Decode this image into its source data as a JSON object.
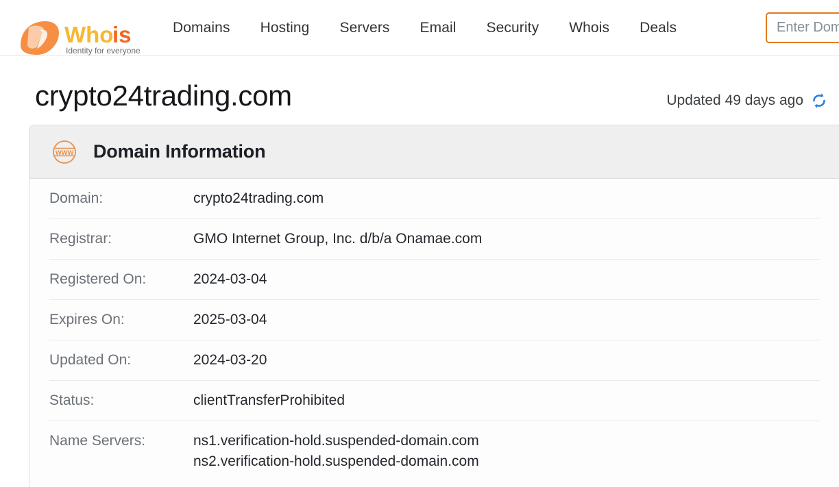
{
  "header": {
    "logo": {
      "name": "whois-logo",
      "word_primary": "Who",
      "word_accent": "is",
      "tagline": "Identity for everyone",
      "mark_color": "#f58634",
      "primary_color": "#f7b731",
      "accent_color": "#f26722"
    },
    "nav": [
      {
        "label": "Domains",
        "name": "nav-domains"
      },
      {
        "label": "Hosting",
        "name": "nav-hosting"
      },
      {
        "label": "Servers",
        "name": "nav-servers"
      },
      {
        "label": "Email",
        "name": "nav-email"
      },
      {
        "label": "Security",
        "name": "nav-security"
      },
      {
        "label": "Whois",
        "name": "nav-whois"
      },
      {
        "label": "Deals",
        "name": "nav-deals"
      }
    ],
    "search": {
      "placeholder": "Enter Domain Name",
      "value": "",
      "border_color": "#e07b1f"
    }
  },
  "page": {
    "title": "crypto24trading.com",
    "updated_text": "Updated 49 days ago",
    "refresh_icon": "refresh-icon",
    "refresh_color": "#2f7de1"
  },
  "card": {
    "icon": "www-globe-icon",
    "icon_color": "#e8914e",
    "title": "Domain Information",
    "rows": [
      {
        "label": "Domain:",
        "value": "crypto24trading.com",
        "name": "row-domain"
      },
      {
        "label": "Registrar:",
        "value": "GMO Internet Group, Inc. d/b/a Onamae.com",
        "name": "row-registrar"
      },
      {
        "label": "Registered On:",
        "value": "2024-03-04",
        "name": "row-registered-on"
      },
      {
        "label": "Expires On:",
        "value": "2025-03-04",
        "name": "row-expires-on"
      },
      {
        "label": "Updated On:",
        "value": "2024-03-20",
        "name": "row-updated-on"
      },
      {
        "label": "Status:",
        "value": "clientTransferProhibited",
        "name": "row-status"
      },
      {
        "label": "Name Servers:",
        "value": "",
        "name": "row-name-servers",
        "lines": [
          "ns1.verification-hold.suspended-domain.com",
          "ns2.verification-hold.suspended-domain.com"
        ]
      }
    ]
  }
}
